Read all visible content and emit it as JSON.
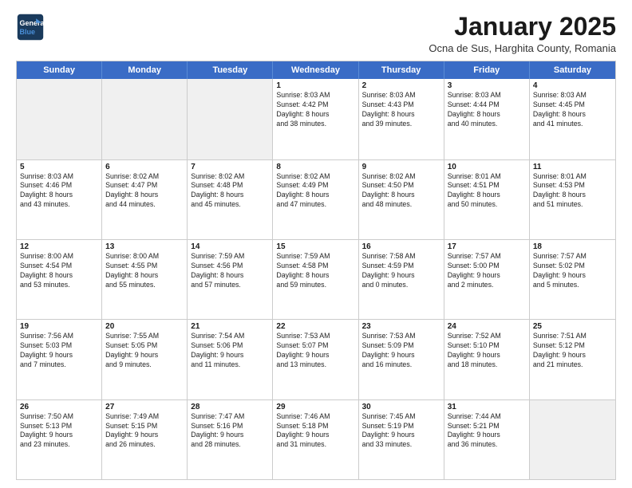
{
  "logo": {
    "line1": "General",
    "line2": "Blue"
  },
  "title": "January 2025",
  "subtitle": "Ocna de Sus, Harghita County, Romania",
  "header_days": [
    "Sunday",
    "Monday",
    "Tuesday",
    "Wednesday",
    "Thursday",
    "Friday",
    "Saturday"
  ],
  "weeks": [
    [
      {
        "day": "",
        "text": "",
        "shaded": true
      },
      {
        "day": "",
        "text": "",
        "shaded": true
      },
      {
        "day": "",
        "text": "",
        "shaded": true
      },
      {
        "day": "1",
        "text": "Sunrise: 8:03 AM\nSunset: 4:42 PM\nDaylight: 8 hours\nand 38 minutes.",
        "shaded": false
      },
      {
        "day": "2",
        "text": "Sunrise: 8:03 AM\nSunset: 4:43 PM\nDaylight: 8 hours\nand 39 minutes.",
        "shaded": false
      },
      {
        "day": "3",
        "text": "Sunrise: 8:03 AM\nSunset: 4:44 PM\nDaylight: 8 hours\nand 40 minutes.",
        "shaded": false
      },
      {
        "day": "4",
        "text": "Sunrise: 8:03 AM\nSunset: 4:45 PM\nDaylight: 8 hours\nand 41 minutes.",
        "shaded": false
      }
    ],
    [
      {
        "day": "5",
        "text": "Sunrise: 8:03 AM\nSunset: 4:46 PM\nDaylight: 8 hours\nand 43 minutes.",
        "shaded": false
      },
      {
        "day": "6",
        "text": "Sunrise: 8:02 AM\nSunset: 4:47 PM\nDaylight: 8 hours\nand 44 minutes.",
        "shaded": false
      },
      {
        "day": "7",
        "text": "Sunrise: 8:02 AM\nSunset: 4:48 PM\nDaylight: 8 hours\nand 45 minutes.",
        "shaded": false
      },
      {
        "day": "8",
        "text": "Sunrise: 8:02 AM\nSunset: 4:49 PM\nDaylight: 8 hours\nand 47 minutes.",
        "shaded": false
      },
      {
        "day": "9",
        "text": "Sunrise: 8:02 AM\nSunset: 4:50 PM\nDaylight: 8 hours\nand 48 minutes.",
        "shaded": false
      },
      {
        "day": "10",
        "text": "Sunrise: 8:01 AM\nSunset: 4:51 PM\nDaylight: 8 hours\nand 50 minutes.",
        "shaded": false
      },
      {
        "day": "11",
        "text": "Sunrise: 8:01 AM\nSunset: 4:53 PM\nDaylight: 8 hours\nand 51 minutes.",
        "shaded": false
      }
    ],
    [
      {
        "day": "12",
        "text": "Sunrise: 8:00 AM\nSunset: 4:54 PM\nDaylight: 8 hours\nand 53 minutes.",
        "shaded": false
      },
      {
        "day": "13",
        "text": "Sunrise: 8:00 AM\nSunset: 4:55 PM\nDaylight: 8 hours\nand 55 minutes.",
        "shaded": false
      },
      {
        "day": "14",
        "text": "Sunrise: 7:59 AM\nSunset: 4:56 PM\nDaylight: 8 hours\nand 57 minutes.",
        "shaded": false
      },
      {
        "day": "15",
        "text": "Sunrise: 7:59 AM\nSunset: 4:58 PM\nDaylight: 8 hours\nand 59 minutes.",
        "shaded": false
      },
      {
        "day": "16",
        "text": "Sunrise: 7:58 AM\nSunset: 4:59 PM\nDaylight: 9 hours\nand 0 minutes.",
        "shaded": false
      },
      {
        "day": "17",
        "text": "Sunrise: 7:57 AM\nSunset: 5:00 PM\nDaylight: 9 hours\nand 2 minutes.",
        "shaded": false
      },
      {
        "day": "18",
        "text": "Sunrise: 7:57 AM\nSunset: 5:02 PM\nDaylight: 9 hours\nand 5 minutes.",
        "shaded": false
      }
    ],
    [
      {
        "day": "19",
        "text": "Sunrise: 7:56 AM\nSunset: 5:03 PM\nDaylight: 9 hours\nand 7 minutes.",
        "shaded": false
      },
      {
        "day": "20",
        "text": "Sunrise: 7:55 AM\nSunset: 5:05 PM\nDaylight: 9 hours\nand 9 minutes.",
        "shaded": false
      },
      {
        "day": "21",
        "text": "Sunrise: 7:54 AM\nSunset: 5:06 PM\nDaylight: 9 hours\nand 11 minutes.",
        "shaded": false
      },
      {
        "day": "22",
        "text": "Sunrise: 7:53 AM\nSunset: 5:07 PM\nDaylight: 9 hours\nand 13 minutes.",
        "shaded": false
      },
      {
        "day": "23",
        "text": "Sunrise: 7:53 AM\nSunset: 5:09 PM\nDaylight: 9 hours\nand 16 minutes.",
        "shaded": false
      },
      {
        "day": "24",
        "text": "Sunrise: 7:52 AM\nSunset: 5:10 PM\nDaylight: 9 hours\nand 18 minutes.",
        "shaded": false
      },
      {
        "day": "25",
        "text": "Sunrise: 7:51 AM\nSunset: 5:12 PM\nDaylight: 9 hours\nand 21 minutes.",
        "shaded": false
      }
    ],
    [
      {
        "day": "26",
        "text": "Sunrise: 7:50 AM\nSunset: 5:13 PM\nDaylight: 9 hours\nand 23 minutes.",
        "shaded": false
      },
      {
        "day": "27",
        "text": "Sunrise: 7:49 AM\nSunset: 5:15 PM\nDaylight: 9 hours\nand 26 minutes.",
        "shaded": false
      },
      {
        "day": "28",
        "text": "Sunrise: 7:47 AM\nSunset: 5:16 PM\nDaylight: 9 hours\nand 28 minutes.",
        "shaded": false
      },
      {
        "day": "29",
        "text": "Sunrise: 7:46 AM\nSunset: 5:18 PM\nDaylight: 9 hours\nand 31 minutes.",
        "shaded": false
      },
      {
        "day": "30",
        "text": "Sunrise: 7:45 AM\nSunset: 5:19 PM\nDaylight: 9 hours\nand 33 minutes.",
        "shaded": false
      },
      {
        "day": "31",
        "text": "Sunrise: 7:44 AM\nSunset: 5:21 PM\nDaylight: 9 hours\nand 36 minutes.",
        "shaded": false
      },
      {
        "day": "",
        "text": "",
        "shaded": true
      }
    ]
  ]
}
